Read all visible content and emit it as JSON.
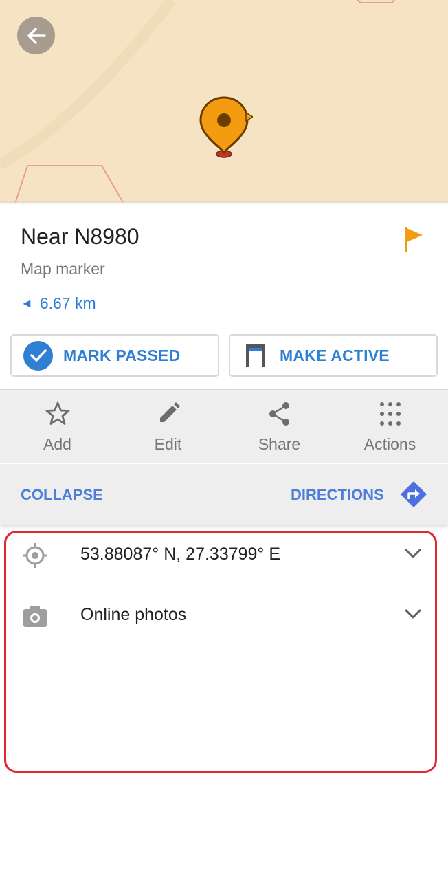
{
  "map": {
    "background": "#f5e3c4",
    "accent_marker": "#f39c12"
  },
  "header": {
    "title": "Near N8980",
    "subtitle": "Map marker",
    "distance": "6.67 km",
    "distance_arrow": "◄"
  },
  "buttons": {
    "mark_passed": "MARK PASSED",
    "make_active": "MAKE ACTIVE"
  },
  "toolbar": {
    "items": [
      {
        "label": "Add",
        "icon": "star-icon"
      },
      {
        "label": "Edit",
        "icon": "pencil-icon"
      },
      {
        "label": "Share",
        "icon": "share-icon"
      },
      {
        "label": "Actions",
        "icon": "grid-dots-icon"
      }
    ]
  },
  "nav": {
    "collapse": "COLLAPSE",
    "directions": "DIRECTIONS"
  },
  "details": {
    "coordinates": "53.88087° N, 27.33799° E",
    "photos": "Online photos"
  },
  "colors": {
    "accent_blue": "#2f7fd3",
    "flag": "#f39c12",
    "highlight_border": "#e02830"
  }
}
